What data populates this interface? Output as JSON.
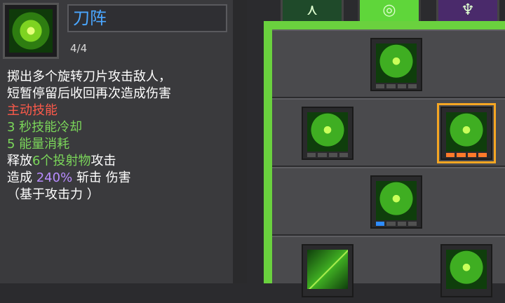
{
  "skill": {
    "name": "刀阵",
    "level": "4/4",
    "icon": "spinning-blade-icon",
    "lines": [
      {
        "text": "掷出多个旋转刀片攻击敌人，",
        "color": "#ffffff"
      },
      {
        "text": "短暂停留后收回再次造成伤害",
        "color": "#ffffff"
      },
      {
        "text": "主动技能",
        "color": "#ff5a4a"
      },
      {
        "text": "3 秒技能冷却",
        "color": "#7bd65a"
      },
      {
        "text": "5 能量消耗",
        "color": "#7bd65a"
      }
    ],
    "release": {
      "prefix": "释放",
      "count": "6个",
      "target": "投射物",
      "suffix": "攻击"
    },
    "damage": {
      "prefix": "造成",
      "value": "240%",
      "suffix": "斩击 伤害"
    },
    "note": "（基于攻击力 ）"
  },
  "tabs": [
    {
      "icon": "tree-branch-icon",
      "active": false
    },
    {
      "icon": "spiral-icon",
      "active": true
    },
    {
      "icon": "crest-icon",
      "active": false
    }
  ],
  "nodes": [
    {
      "icon": "beast-upgrade-icon",
      "pips": [
        "gray",
        "gray",
        "gray",
        "gray"
      ]
    },
    {
      "icon": "burst-arrows-icon",
      "pips": [
        "gray",
        "gray",
        "gray",
        "gray"
      ]
    },
    {
      "icon": "spinning-blade-icon",
      "pips": [
        "orange",
        "orange",
        "orange",
        "orange"
      ],
      "selected": true
    },
    {
      "icon": "orbs-icon",
      "pips": [
        "blue",
        "gray",
        "gray",
        "gray"
      ]
    },
    {
      "icon": "slash-icon",
      "pips": []
    },
    {
      "icon": "owl-icon",
      "pips": []
    }
  ]
}
